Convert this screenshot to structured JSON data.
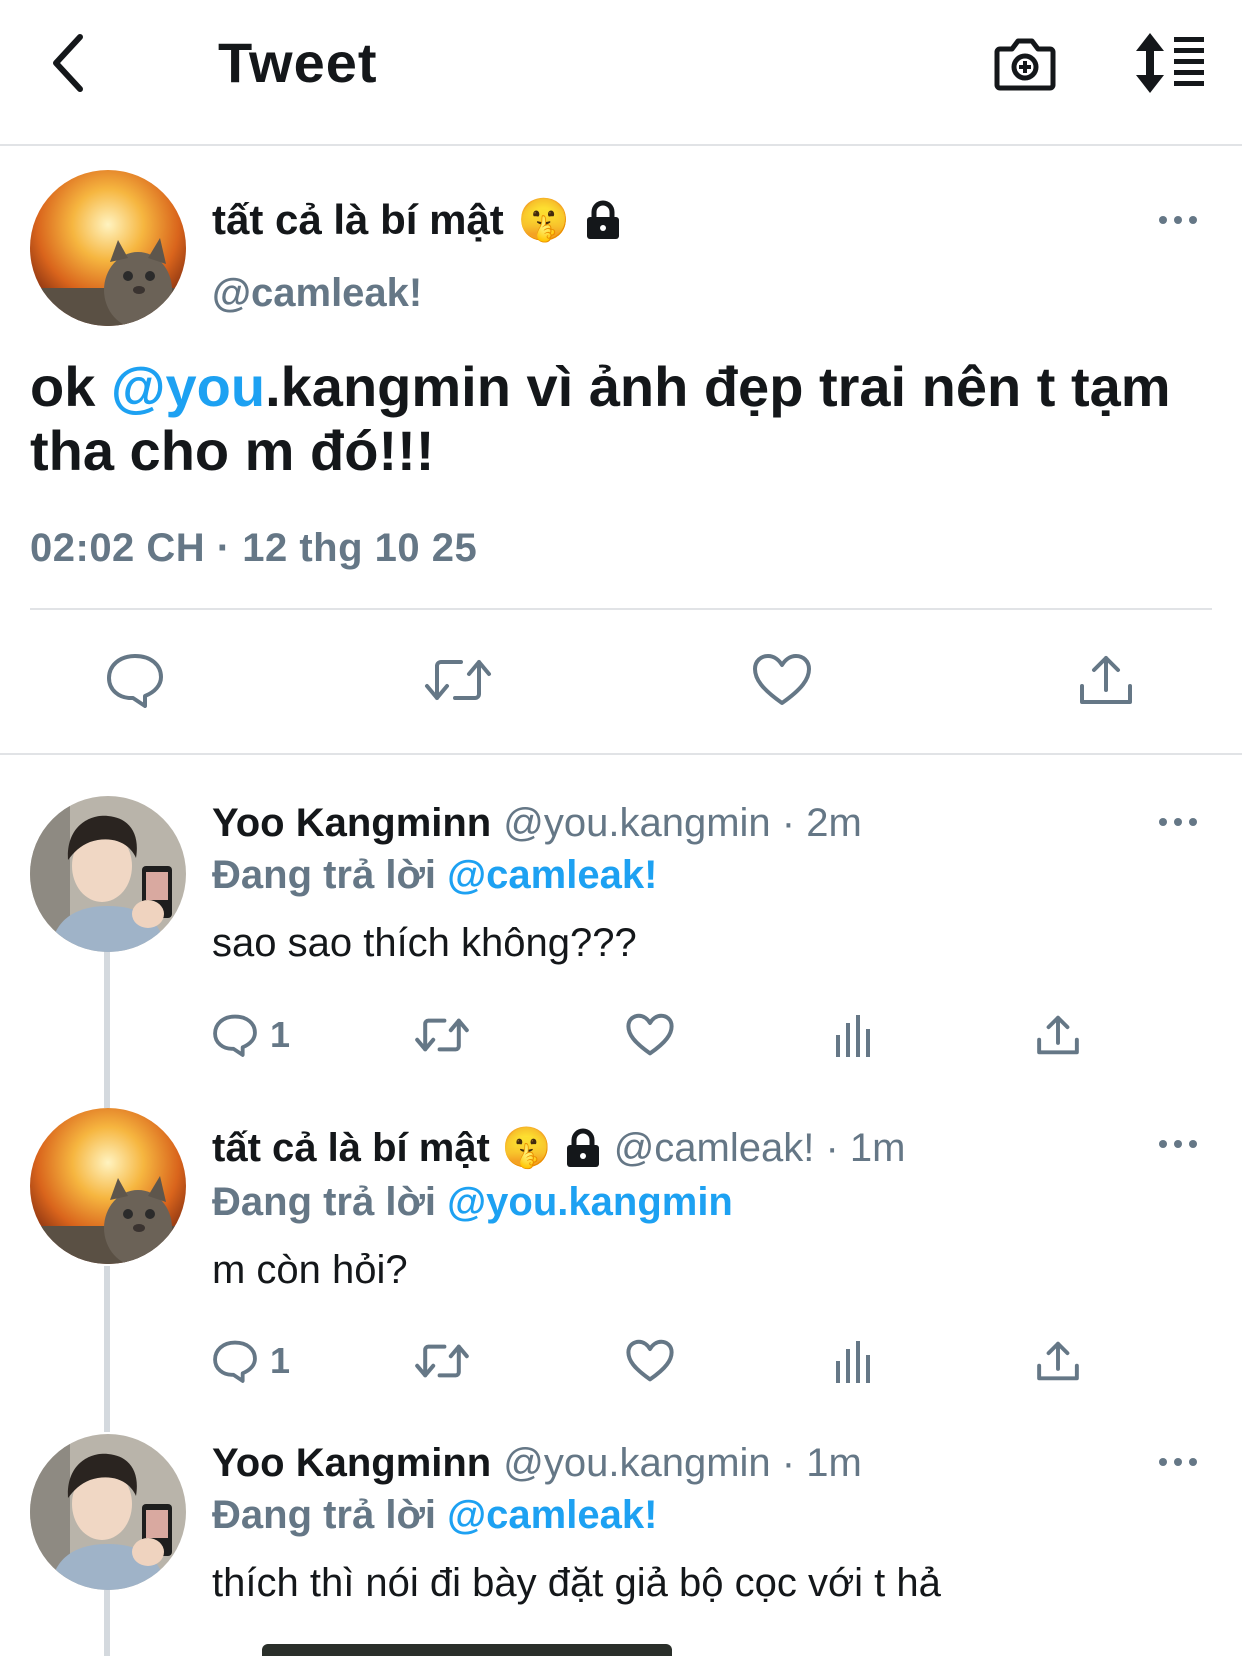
{
  "header": {
    "title": "Tweet"
  },
  "main_tweet": {
    "name": "tất cả là bí mật",
    "emoji": "🤫",
    "handle": "@camleak!",
    "text_prefix": "ok ",
    "text_mention": "@you",
    "text_suffix": ".kangmin vì ảnh đẹp trai nên t tạm tha cho m đó!!!",
    "time": "02:02 CH · 12 thg 10 25"
  },
  "replies": [
    {
      "name": "Yoo Kangminn",
      "handle": "@you.kangmin · 2m",
      "replying_label": "Đang trả lời",
      "replying_to": "@camleak!",
      "text": "sao sao thích không???",
      "reply_count": "1"
    },
    {
      "name": "tất cả là bí mật",
      "emoji": "🤫",
      "handle": "@camleak! · 1m",
      "replying_label": "Đang trả lời",
      "replying_to": "@you.kangmin",
      "text": "m còn hỏi?",
      "reply_count": "1"
    },
    {
      "name": "Yoo Kangminn",
      "handle": "@you.kangmin · 1m",
      "replying_label": "Đang trả lời",
      "replying_to": "@camleak!",
      "text": "thích thì nói đi bày đặt giả bộ cọc với t hả"
    }
  ],
  "colors": {
    "accent": "#1da1f2",
    "secondary": "#657786",
    "text": "#14171a",
    "divider": "#e1e3e6"
  }
}
